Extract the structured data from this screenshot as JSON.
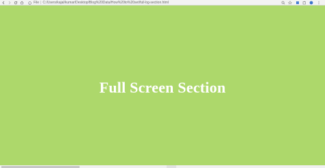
{
  "browser": {
    "address": {
      "scheme_label": "File",
      "path": "C:/Users/kajal/kumar/Desktop/Blog%20Data/How%20to%20set/full-bg-section.html"
    }
  },
  "section": {
    "heading": "Full Screen Section",
    "background_color": "#add86b",
    "text_color": "#ffffff"
  }
}
